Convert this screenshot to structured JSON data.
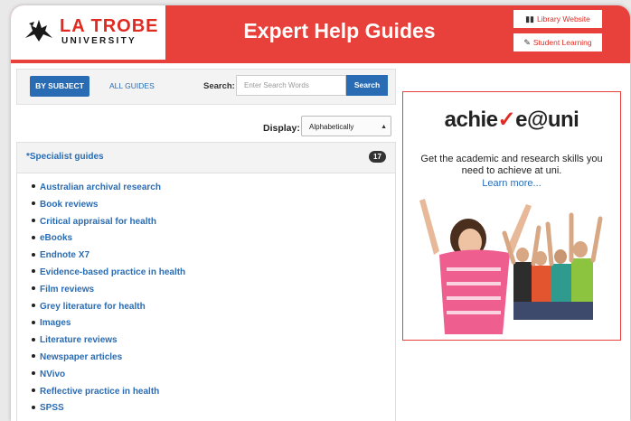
{
  "brand": {
    "logo_main": "LA TROBE",
    "logo_sub": "UNIVERSITY",
    "accent_color": "#e8403a",
    "link_color": "#2a6cb3"
  },
  "header": {
    "title": "Expert Help Guides",
    "library_label": "Library Website",
    "student_label": "Student Learning"
  },
  "toolbar": {
    "by_subject": "BY SUBJECT",
    "all_guides": "ALL GUIDES",
    "search_label": "Search:",
    "search_placeholder": "Enter Search Words",
    "search_button": "Search"
  },
  "display": {
    "label": "Display:",
    "selected": "Alphabetically"
  },
  "panel": {
    "title": "*Specialist guides",
    "count": "17",
    "items": [
      "Australian archival research",
      "Book reviews",
      "Critical appraisal for health",
      "eBooks",
      "Endnote X7",
      "Evidence-based practice in health",
      "Film reviews",
      "Grey literature for health",
      "Images",
      "Literature reviews",
      "Newspaper articles",
      "NVivo",
      "Reflective practice in health",
      "SPSS"
    ]
  },
  "promo": {
    "brand_prefix": "achie",
    "brand_mark": "✓",
    "brand_suffix": "e@uni",
    "text": "Get the academic and research skills you need to achieve at uni.",
    "link": "Learn more..."
  }
}
